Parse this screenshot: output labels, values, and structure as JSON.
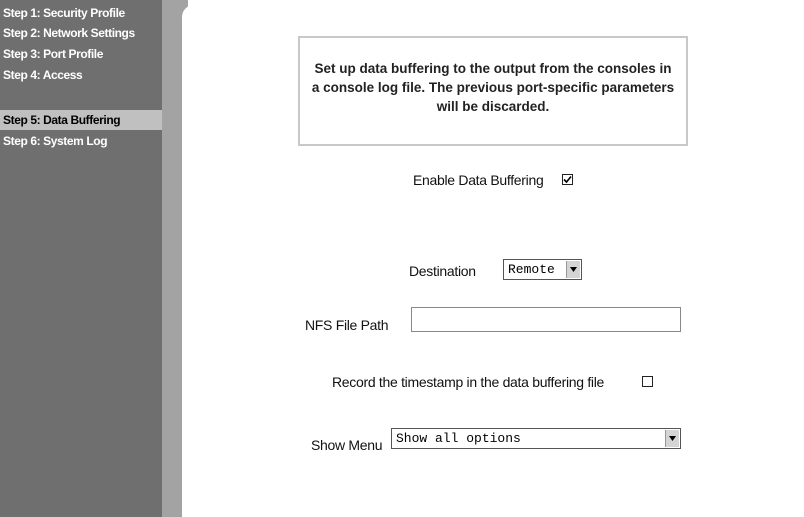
{
  "sidebar": {
    "items": [
      {
        "label": "Step 1: Security Profile"
      },
      {
        "label": "Step 2: Network Settings"
      },
      {
        "label": "Step 3: Port Profile"
      },
      {
        "label": "Step 4: Access"
      },
      {
        "label": "Step 5: Data Buffering",
        "active": true
      },
      {
        "label": "Step 6: System Log"
      }
    ]
  },
  "main": {
    "info_text": "Set up data buffering to the output from the consoles in a console log file. The previous port-specific parameters will be discarded.",
    "enable_buffering": {
      "label": "Enable Data Buffering",
      "checked": true
    },
    "destination": {
      "label": "Destination",
      "value": "Remote"
    },
    "nfs_path": {
      "label": "NFS File Path",
      "value": ""
    },
    "timestamp": {
      "label": "Record the timestamp in the data buffering file",
      "checked": false
    },
    "show_menu": {
      "label": "Show Menu",
      "value": "Show all options"
    }
  },
  "colors": {
    "sidebar_bg": "#6f6f6f",
    "sidebar_active_bg": "#c0c0c0",
    "gutter_bg": "#a3a3a3"
  }
}
